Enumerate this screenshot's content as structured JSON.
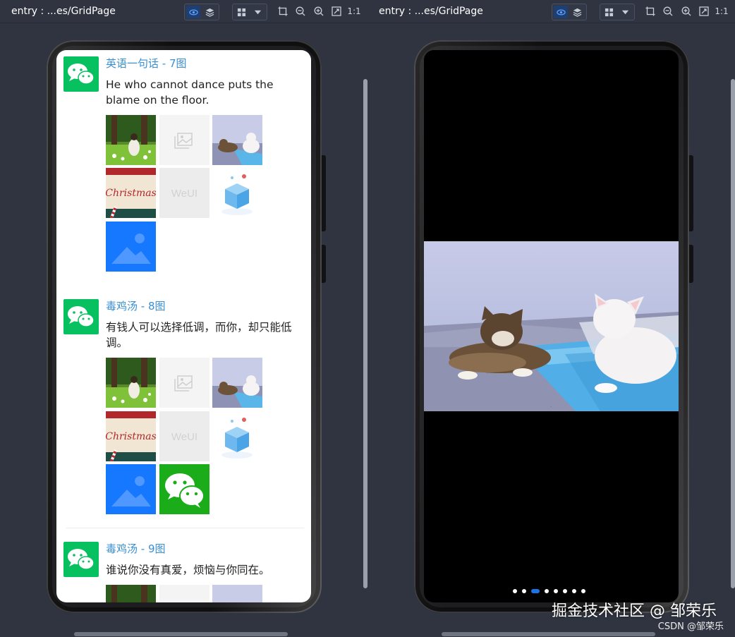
{
  "toolbar_left": {
    "title": "entry : ...es/GridPage",
    "ratio": "1:1"
  },
  "toolbar_right": {
    "title": "entry : ...es/GridPage",
    "ratio": "1:1"
  },
  "posts": [
    {
      "title": "英语一句话 - 7图",
      "text": "He who cannot dance puts the blame on the floor.",
      "thumbs": [
        "forest-girl",
        "placeholder",
        "cats",
        "christmas",
        "weui",
        "giftbox",
        "image-blue"
      ]
    },
    {
      "title": "毒鸡汤 - 8图",
      "text": "有钱人可以选择低调，而你，却只能低调。",
      "thumbs": [
        "forest-girl",
        "placeholder",
        "cats",
        "christmas",
        "weui",
        "giftbox",
        "image-blue",
        "wechat"
      ]
    },
    {
      "title": "毒鸡汤 - 9图",
      "text": "谁说你没有真爱，烦恼与你同在。",
      "thumbs": [
        "forest-girl",
        "placeholder",
        "cats"
      ]
    }
  ],
  "weui_label": "WeUI",
  "viewer": {
    "dot_count": 8,
    "active_index": 2
  },
  "watermark": {
    "main": "掘金技术社区 @ 邹荣乐",
    "sub": "CSDN @邹荣乐"
  },
  "colors": {
    "accent": "#3a8fd0",
    "wechat_green": "#07c160",
    "dot_active": "#1a73e8"
  }
}
